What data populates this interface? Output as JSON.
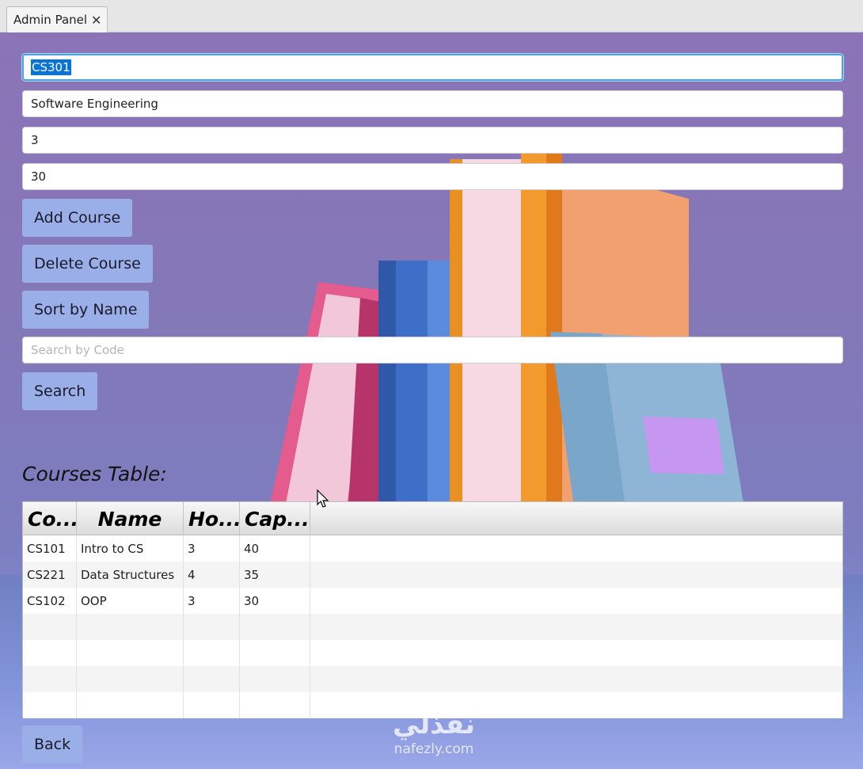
{
  "window": {
    "tab_label": "Admin Panel",
    "tab_close": "✕"
  },
  "form": {
    "code_value": "CS301",
    "name_value": "Software Engineering",
    "hours_value": "3",
    "capacity_value": "30",
    "search_placeholder": "Search by Code"
  },
  "buttons": {
    "add": "Add Course",
    "delete": "Delete Course",
    "sort": "Sort by Name",
    "search": "Search",
    "back": "Back"
  },
  "table": {
    "title": "Courses Table:",
    "columns": [
      "Co...",
      "Name",
      "Ho...",
      "Cap..."
    ],
    "rows": [
      [
        "CS101",
        "Intro to CS",
        "3",
        "40"
      ],
      [
        "CS221",
        "Data Structures",
        "4",
        "35"
      ],
      [
        "CS102",
        "OOP",
        "3",
        "30"
      ],
      [
        "",
        "",
        "",
        ""
      ],
      [
        "",
        "",
        "",
        ""
      ],
      [
        "",
        "",
        "",
        ""
      ],
      [
        "",
        "",
        "",
        ""
      ]
    ]
  },
  "watermark": {
    "arabic": "نفذلي",
    "latin": "nafezly.com"
  },
  "colors": {
    "button_bg": "#9aaee8",
    "background_top": "#8b74b7",
    "selection": "#0a74d6"
  }
}
